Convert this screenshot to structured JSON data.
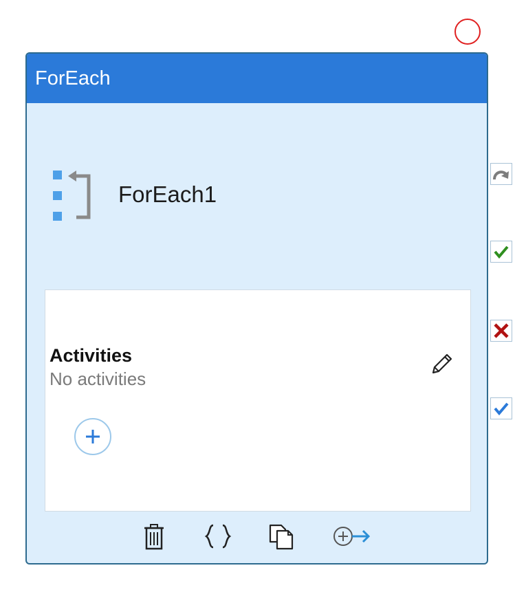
{
  "header": {
    "title": "ForEach"
  },
  "activity": {
    "name": "ForEach1",
    "icon": "foreach-icon"
  },
  "activities_section": {
    "title": "Activities",
    "status": "No activities"
  },
  "toolbar": {
    "items": [
      "trash-icon",
      "code-braces-icon",
      "copy-icon",
      "add-output-icon"
    ]
  },
  "side_handles": [
    "skip-icon",
    "success-check-icon",
    "failure-x-icon",
    "completion-check-icon"
  ],
  "colors": {
    "header": "#2b7ad9",
    "card_background": "#ddeefc",
    "success": "#2f8f1f",
    "failure": "#b11212",
    "completion": "#2b7ad9",
    "status_circle": "#e02020"
  }
}
